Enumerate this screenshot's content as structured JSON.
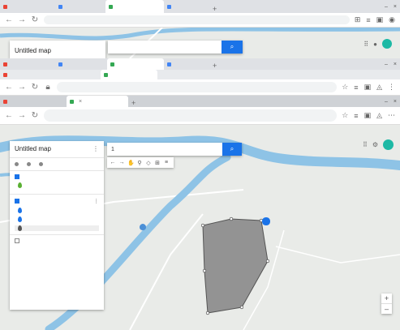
{
  "back_window": {
    "tabs": [
      {
        "label": "",
        "favicon_color": "#ea4335"
      },
      {
        "label": "",
        "favicon_color": "#4285f4"
      },
      {
        "label": "",
        "favicon_color": "#34a853"
      },
      {
        "label": "",
        "favicon_color": "#4285f4"
      }
    ],
    "new_tab_label": "+",
    "win_controls": {
      "minimize": "–",
      "close": "×"
    },
    "url": {
      "host": "",
      "path": ""
    },
    "ext_icons": [
      "⊞",
      "≡",
      "▣",
      "◉"
    ],
    "map_search_button": "⌕",
    "map_panel_title": "Untitled map",
    "map_topright": {
      "apps": "⠿",
      "user": "●"
    }
  },
  "middle_window": {
    "tabs": [
      {
        "label": "",
        "favicon_color": "#ea4335"
      },
      {
        "label": "",
        "favicon_color": "#4285f4"
      },
      {
        "label": "",
        "favicon_color": "#34a853"
      },
      {
        "label": "",
        "favicon_color": "#4285f4"
      }
    ],
    "new_tab_label": "+",
    "win_controls": {
      "minimize": "–",
      "close": "×"
    },
    "second_row_tabs": [
      {
        "label": "",
        "favicon_color": "#ea4335"
      },
      {
        "label": "",
        "favicon_color": "#34a853"
      }
    ],
    "url": {
      "host": "",
      "path": ""
    },
    "ext_icons": [
      "☆",
      "≡",
      "▣",
      "◬",
      "⋮"
    ]
  },
  "front_window": {
    "tabs": [
      {
        "label": "",
        "favicon_color": "#ea4335",
        "active": false
      },
      {
        "label": "",
        "favicon_color": "#34a853",
        "active": true
      }
    ],
    "tab_close": "×",
    "new_tab_label": "+",
    "win_controls": {
      "minimize": "–",
      "close": "×"
    },
    "nav": {
      "back": "←",
      "forward": "→",
      "reload": "↻"
    },
    "url": {
      "host": "",
      "path": ""
    },
    "ext_icons": [
      "☆",
      "≡",
      "▣",
      "◬",
      "⋯"
    ],
    "map": {
      "panel": {
        "title": "Untitled map",
        "subtitle": "",
        "menu": "⋮",
        "actions": [
          "",
          "",
          ""
        ],
        "layers": [
          {
            "title": "",
            "checked": true,
            "rows": [
              {
                "label": "",
                "pin_color": "#5ab033"
              }
            ],
            "style_link": ""
          },
          {
            "title": "",
            "checked": true,
            "style_link": "",
            "rows": [
              {
                "label": "",
                "pin_color": "#1a73e8",
                "selected": false
              },
              {
                "label": "",
                "pin_color": "#1a73e8",
                "selected": false
              },
              {
                "label": "",
                "pin_color": "#555555",
                "selected": true
              }
            ]
          }
        ],
        "base_map": ""
      },
      "search": {
        "value": "1",
        "button": "⌕"
      },
      "tools": [
        "←",
        "→",
        "✋",
        "⚲",
        "◇",
        "⊞",
        "≡"
      ],
      "topright": {
        "apps": "⠿",
        "settings": "⚙",
        "avatar_color": "#1db9a5"
      },
      "labels": [
        "",
        ""
      ],
      "zoom": {
        "in": "+",
        "out": "–"
      }
    }
  },
  "colors": {
    "river": "#8ec3e6",
    "polygon_fill": "#8a8a8a",
    "road": "#ffffff",
    "accent": "#1a73e8"
  }
}
